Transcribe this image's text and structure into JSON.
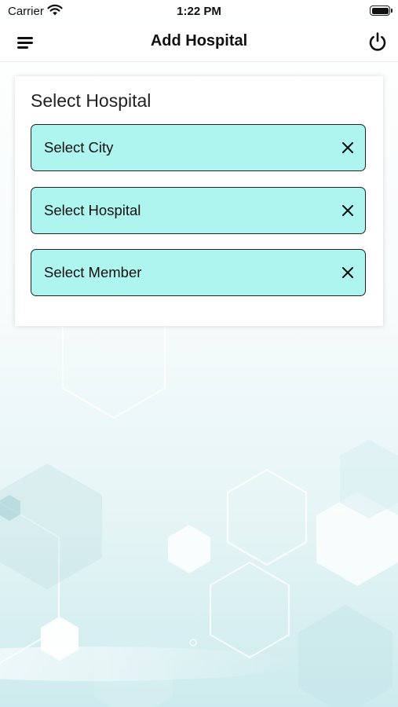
{
  "status_bar": {
    "carrier": "Carrier",
    "time": "1:22 PM"
  },
  "nav_bar": {
    "title": "Add Hospital",
    "menu_icon": "hamburger-menu-icon",
    "power_icon": "power-icon"
  },
  "card": {
    "title": "Select Hospital",
    "fields": [
      {
        "label": "Select City"
      },
      {
        "label": "Select Hospital"
      },
      {
        "label": "Select Member"
      }
    ]
  },
  "colors": {
    "field_fill": "#aef5f0",
    "field_border": "#222222",
    "background_tint": "#cfeff0"
  }
}
